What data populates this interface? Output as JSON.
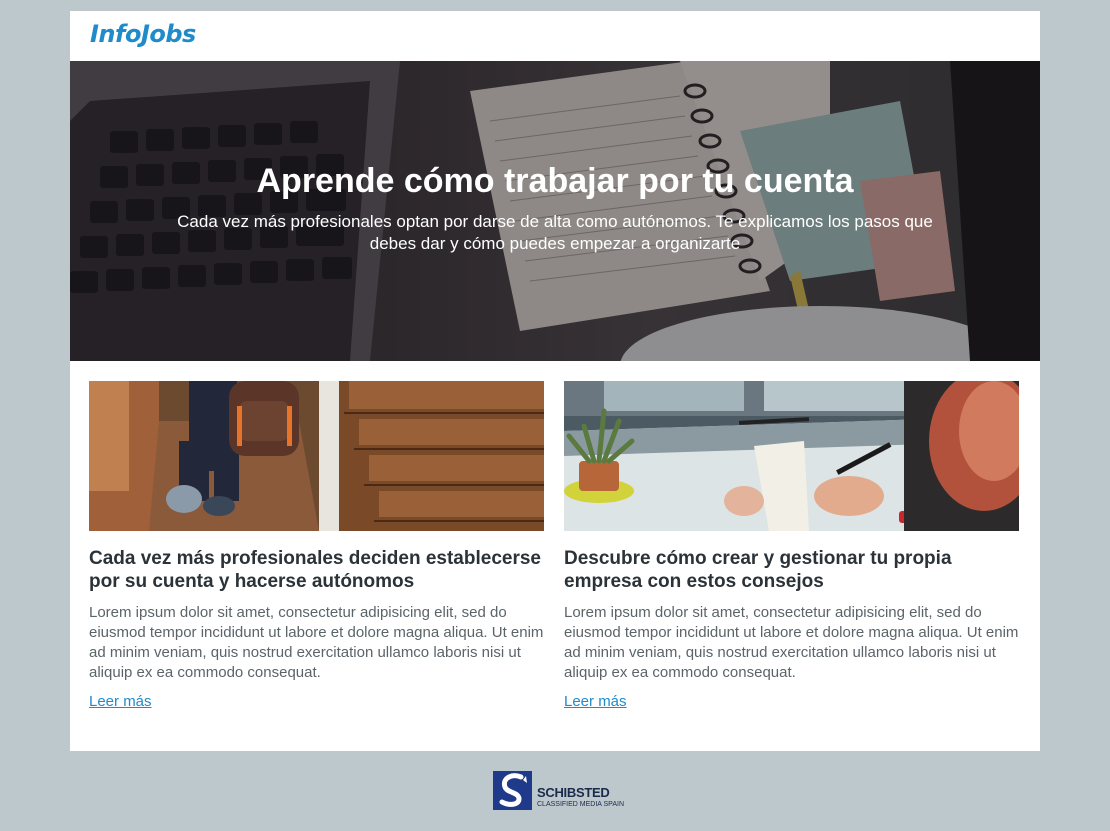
{
  "brand": {
    "logo": "InfoJobs"
  },
  "hero": {
    "title": "Aprende cómo trabajar por tu cuenta",
    "subtitle": "Cada vez más profesionales optan por darse de alta como autónomos. Te explicamos los pasos que debes dar y cómo puedes empezar a organizarte"
  },
  "articles": [
    {
      "title": "Cada vez más profesionales deciden establecerse por su cuenta y hacerse autónomos",
      "body": "Lorem ipsum dolor sit amet, consectetur adipisicing elit, sed do eiusmod tempor incididunt ut labore et dolore magna aliqua. Ut enim ad minim veniam, quis nostrud exercitation ullamco laboris nisi ut aliquip ex ea commodo consequat.",
      "link": "Leer más"
    },
    {
      "title": "Descubre cómo crear y gestionar tu propia empresa con estos consejos",
      "body": "Lorem ipsum dolor sit amet, consectetur adipisicing elit, sed do eiusmod tempor incididunt ut labore et dolore magna aliqua. Ut enim ad minim veniam, quis nostrud exercitation ullamco laboris nisi ut aliquip ex ea commodo consequat.",
      "link": "Leer más"
    }
  ],
  "footer": {
    "brand": "SCHIBSTED",
    "tagline": "CLASSIFIED MEDIA SPAIN"
  },
  "colors": {
    "background": "#bdc8cd",
    "accent": "#1f8bcb",
    "card": "#ffffff"
  }
}
